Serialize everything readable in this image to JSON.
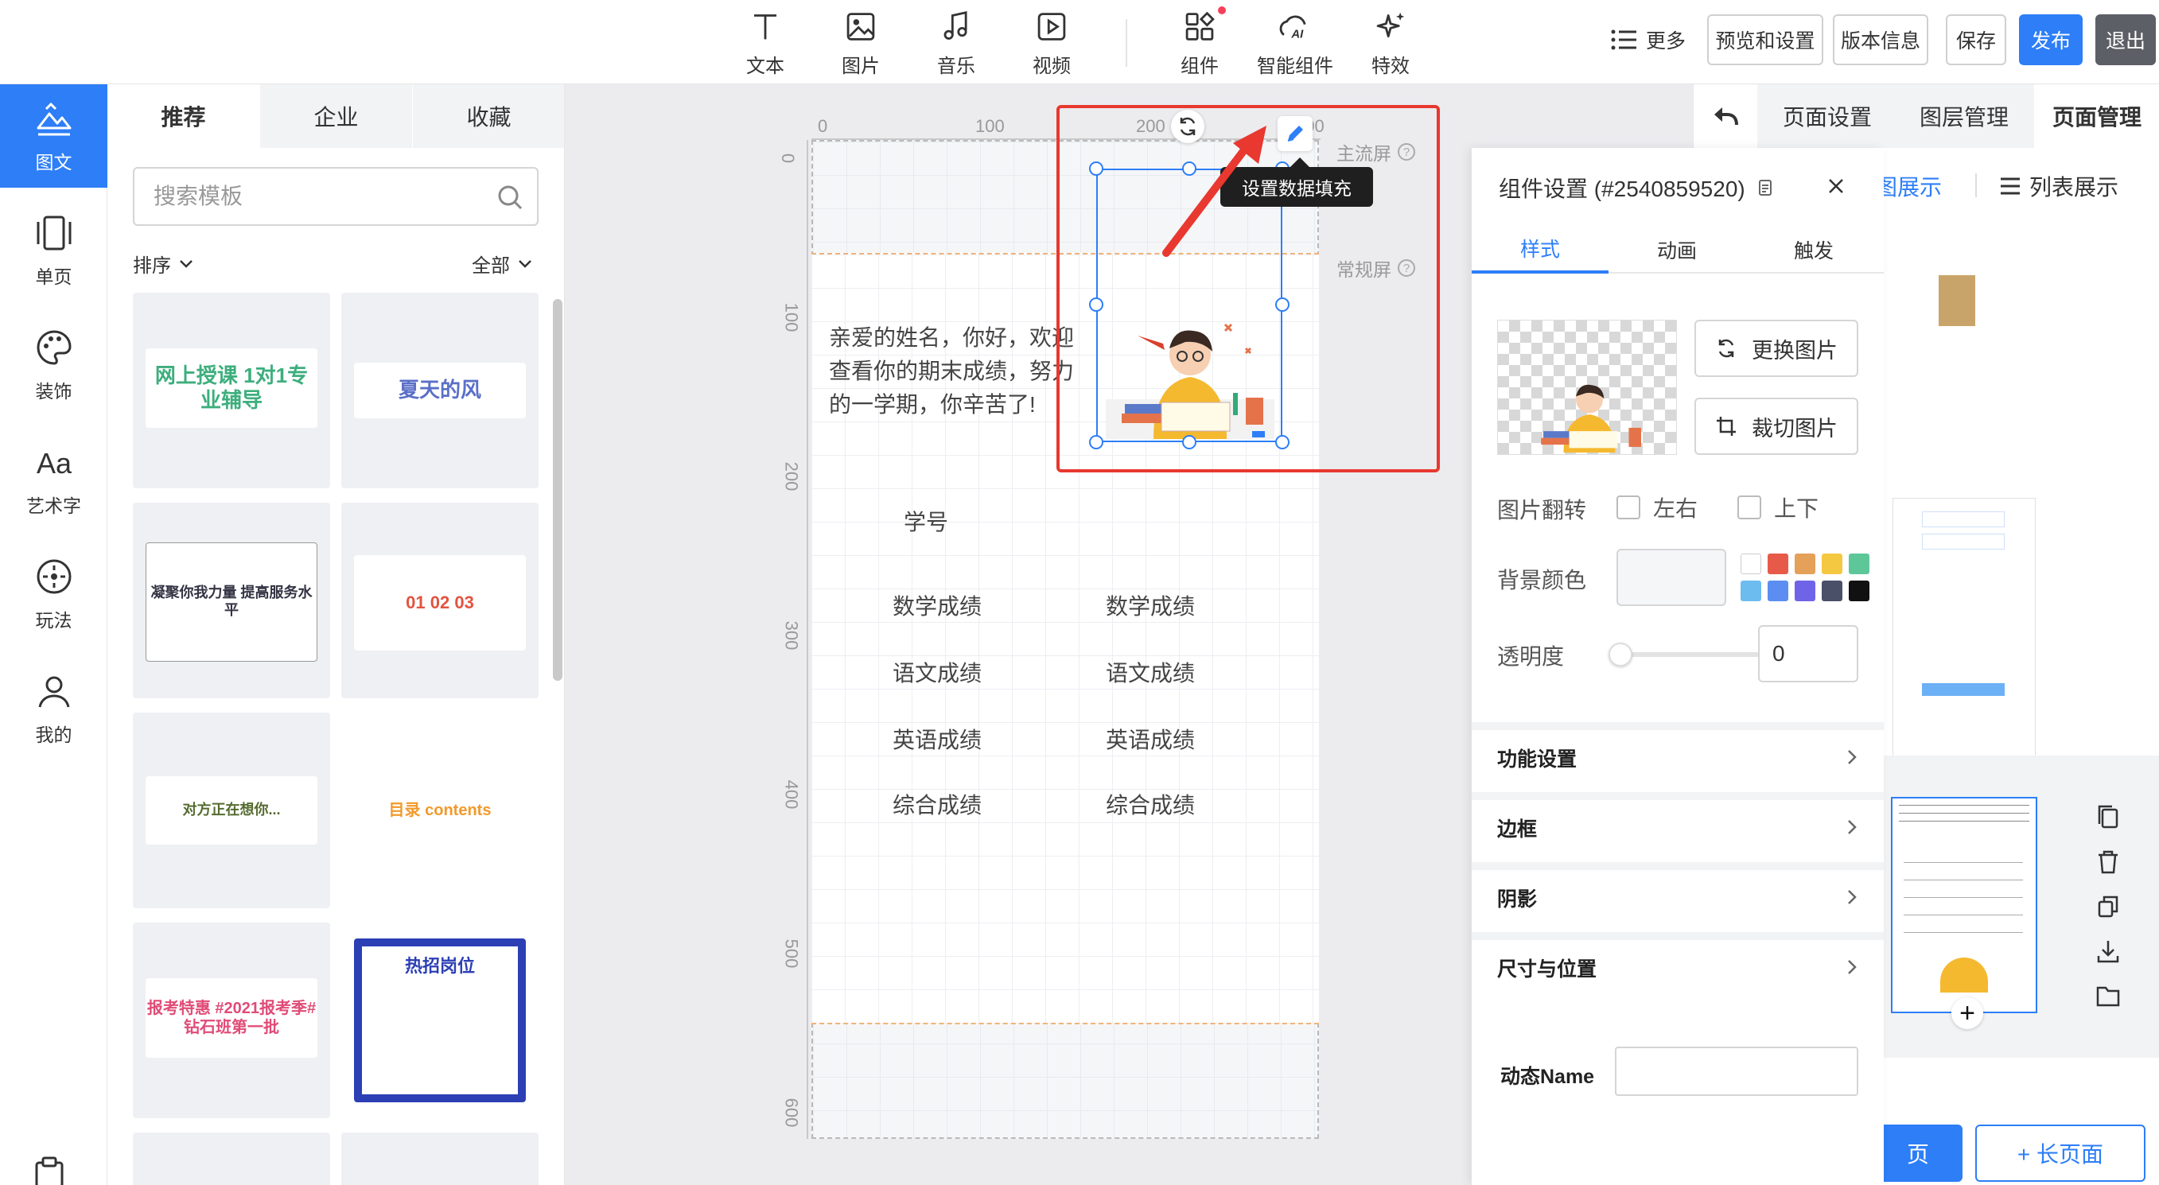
{
  "toolbar": {
    "tools": [
      {
        "label": "文本",
        "icon": "text-icon"
      },
      {
        "label": "图片",
        "icon": "image-icon"
      },
      {
        "label": "音乐",
        "icon": "music-icon"
      },
      {
        "label": "视频",
        "icon": "video-icon"
      },
      {
        "label": "组件",
        "icon": "component-icon",
        "badge": true
      },
      {
        "label": "智能组件",
        "icon": "ai-icon"
      },
      {
        "label": "特效",
        "icon": "sparkle-icon"
      }
    ],
    "more": "更多",
    "preview_settings": "预览和设置",
    "version_info": "版本信息",
    "save": "保存",
    "publish": "发布",
    "exit": "退出"
  },
  "rail": [
    {
      "label": "图文",
      "icon": "graphic-icon",
      "active": true
    },
    {
      "label": "单页",
      "icon": "single-page-icon"
    },
    {
      "label": "装饰",
      "icon": "palette-icon"
    },
    {
      "label": "艺术字",
      "icon": "art-text-icon"
    },
    {
      "label": "玩法",
      "icon": "play-icon"
    },
    {
      "label": "我的",
      "icon": "user-icon"
    }
  ],
  "templates": {
    "tabs": [
      "推荐",
      "企业",
      "收藏"
    ],
    "search_placeholder": "搜索模板",
    "sort": "排序",
    "filter": "全部",
    "cards": [
      {
        "text": "网上授课 1对1专业辅导",
        "color": "#3dae7d"
      },
      {
        "text": "夏天的风",
        "color": "#5a6fc8"
      },
      {
        "text": "凝聚你我力量 提高服务水平",
        "color": "#334"
      },
      {
        "text": "01 02 03",
        "color": "#e3533f"
      },
      {
        "text": "对方正在想你...",
        "color": "#556b2f"
      },
      {
        "text": "目录 contents",
        "color": "#f19a2a"
      },
      {
        "text": "报考特惠 #2021报考季#钻石班第一批",
        "color": "#e04c77"
      },
      {
        "text": "热招岗位",
        "color": "#2c3fb5"
      }
    ]
  },
  "ruler": {
    "top": [
      "0",
      "100",
      "200",
      "300"
    ],
    "left": [
      "0",
      "100",
      "200",
      "300",
      "400",
      "500",
      "600"
    ]
  },
  "canvas": {
    "main_screen": "主流屏",
    "normal_screen": "常规屏",
    "greeting": "亲爱的姓名，你好，欢迎查看你的期末成绩，努力的一学期，你辛苦了!",
    "student_id": "学号",
    "scores_left": [
      "数学成绩",
      "语文成绩",
      "英语成绩",
      "综合成绩"
    ],
    "scores_right": [
      "数学成绩",
      "语文成绩",
      "英语成绩",
      "综合成绩"
    ],
    "tooltip": "设置数据填充"
  },
  "right_panel": {
    "tabs": [
      "页面设置",
      "图层管理",
      "页面管理"
    ],
    "view_grid": "图展示",
    "view_list": "列表展示",
    "add_page": "页",
    "add_long_page": "+ 长页面"
  },
  "component_settings": {
    "title": "组件设置 (#2540859520)",
    "tabs": [
      "样式",
      "动画",
      "触发"
    ],
    "replace_image": "更换图片",
    "crop_image": "裁切图片",
    "flip_label": "图片翻转",
    "flip_lr": "左右",
    "flip_ud": "上下",
    "bg_color_label": "背景颜色",
    "opacity_label": "透明度",
    "opacity_value": "0",
    "opacity": 0,
    "swatches": [
      "#ffffff",
      "#e75a4a",
      "#e5a05a",
      "#f5c842",
      "#5ec79a",
      "#6cbcf0",
      "#5b8ef0",
      "#6f64e8",
      "#4a5068",
      "#111111"
    ],
    "sections": [
      "功能设置",
      "边框",
      "阴影",
      "尺寸与位置"
    ],
    "dynamic_name_label": "动态Name",
    "dynamic_name_value": ""
  }
}
